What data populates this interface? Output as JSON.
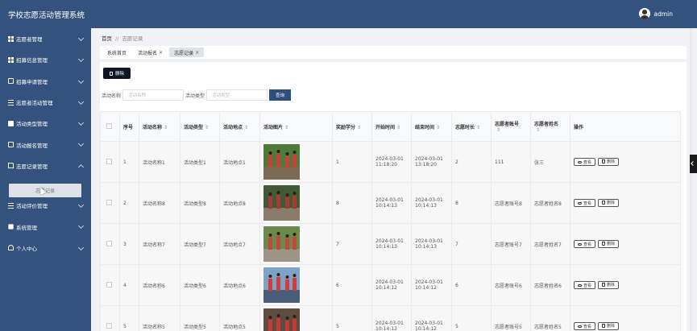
{
  "app": {
    "title": "学校志愿活动管理系统",
    "user": "admin"
  },
  "sidebar": {
    "items": [
      {
        "label": "志愿者管理",
        "icon": "grid-icon",
        "expanded": false
      },
      {
        "label": "招募信息管理",
        "icon": "grid-icon",
        "expanded": false
      },
      {
        "label": "招募申请管理",
        "icon": "box-icon",
        "expanded": false
      },
      {
        "label": "志愿者活动管理",
        "icon": "list-icon",
        "expanded": false
      },
      {
        "label": "活动类型管理",
        "icon": "message-icon",
        "expanded": false
      },
      {
        "label": "活动报名管理",
        "icon": "box-icon",
        "expanded": false
      },
      {
        "label": "志愿记录管理",
        "icon": "document-icon",
        "expanded": true
      },
      {
        "label": "活动评价管理",
        "icon": "list-icon",
        "expanded": false
      },
      {
        "label": "系统管理",
        "icon": "cube-icon",
        "expanded": false
      },
      {
        "label": "个人中心",
        "icon": "user-icon",
        "expanded": false
      }
    ],
    "submenu_label": "志愿记录"
  },
  "breadcrumb": {
    "home": "首页",
    "separator": "//",
    "current": "志愿记录"
  },
  "tabs": [
    {
      "label": "系统首页",
      "closable": false,
      "active": false
    },
    {
      "label": "活动报名",
      "closable": true,
      "active": false
    },
    {
      "label": "志愿记录",
      "closable": true,
      "active": true
    }
  ],
  "toolbar": {
    "delete_label": "删除"
  },
  "search": {
    "name_label": "活动名称",
    "name_placeholder": "活动名称",
    "type_label": "活动类型",
    "type_placeholder": "活动类型",
    "search_label": "查询"
  },
  "table": {
    "columns": [
      "序号",
      "活动名称",
      "活动类型",
      "活动地点",
      "活动图片",
      "奖励学分",
      "开始时间",
      "结束时间",
      "志愿时长",
      "志愿者账号",
      "志愿者姓名",
      "操作"
    ],
    "view_label": "查看",
    "delete_label": "删除",
    "rows": [
      {
        "index": "1",
        "name": "活动名称1",
        "type": "活动类型1",
        "place": "活动地点1",
        "photo_colors": [
          "#4e7a3a",
          "#c8413a",
          "#7c6a55"
        ],
        "credit": "1",
        "start": "2024-03-01 11:18:20",
        "end": "2024-03-01 13:18:20",
        "duration": "2",
        "account": "111",
        "vname": "张三"
      },
      {
        "index": "2",
        "name": "活动名称8",
        "type": "活动类型8",
        "place": "活动地点8",
        "photo_colors": [
          "#3f5a34",
          "#a83a33",
          "#8a7b6a"
        ],
        "credit": "8",
        "start": "2024-03-01 10:14:13",
        "end": "2024-03-01 10:14:13",
        "duration": "8",
        "account": "志愿者账号8",
        "vname": "志愿者姓名8"
      },
      {
        "index": "3",
        "name": "活动名称7",
        "type": "活动类型7",
        "place": "活动地点7",
        "photo_colors": [
          "#6b8a4c",
          "#c24a3d",
          "#9c9486"
        ],
        "credit": "7",
        "start": "2024-03-01 10:14:13",
        "end": "2024-03-01 10:14:13",
        "duration": "7",
        "account": "志愿者账号7",
        "vname": "志愿者姓名7"
      },
      {
        "index": "4",
        "name": "活动名称6",
        "type": "活动类型6",
        "place": "活动地点6",
        "photo_colors": [
          "#7fa1c6",
          "#cf3d3d",
          "#4a5d77"
        ],
        "credit": "6",
        "start": "2024-03-01 10:14:12",
        "end": "2024-03-01 10:14:12",
        "duration": "6",
        "account": "志愿者账号6",
        "vname": "志愿者姓名6"
      },
      {
        "index": "5",
        "name": "活动名称5",
        "type": "活动类型5",
        "place": "活动地点5",
        "photo_colors": [
          "#5d4c3f",
          "#c63a34",
          "#8f8678"
        ],
        "credit": "5",
        "start": "2024-03-01 10:14:12",
        "end": "2024-03-01 10:14:12",
        "duration": "5",
        "account": "志愿者账号5",
        "vname": "志愿者姓名5"
      }
    ]
  },
  "colors": {
    "primary": "#34527e",
    "search_button": "#2e4f7c",
    "delete_button": "#0e1626"
  }
}
